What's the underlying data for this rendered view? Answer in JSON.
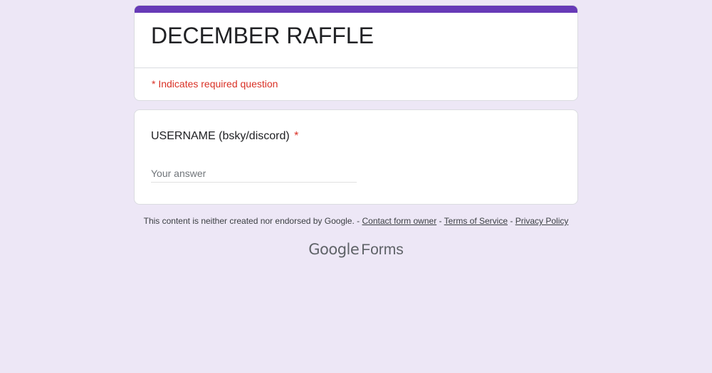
{
  "form": {
    "title": "DECEMBER RAFFLE",
    "required_note": "* Indicates required question",
    "accent_color": "#673ab7",
    "background_color": "#ede7f6"
  },
  "question": {
    "label": "USERNAME (bsky/discord)",
    "required_marker": "*",
    "answer_placeholder": "Your answer",
    "answer_value": ""
  },
  "footer": {
    "disclaimer": "This content is neither created nor endorsed by Google.",
    "sep1": " - ",
    "contact_link": "Contact form owner",
    "sep2": " - ",
    "terms_link": "Terms of Service",
    "sep3": " - ",
    "privacy_link": "Privacy Policy"
  },
  "brand": {
    "google": "Google",
    "forms": "Forms"
  }
}
